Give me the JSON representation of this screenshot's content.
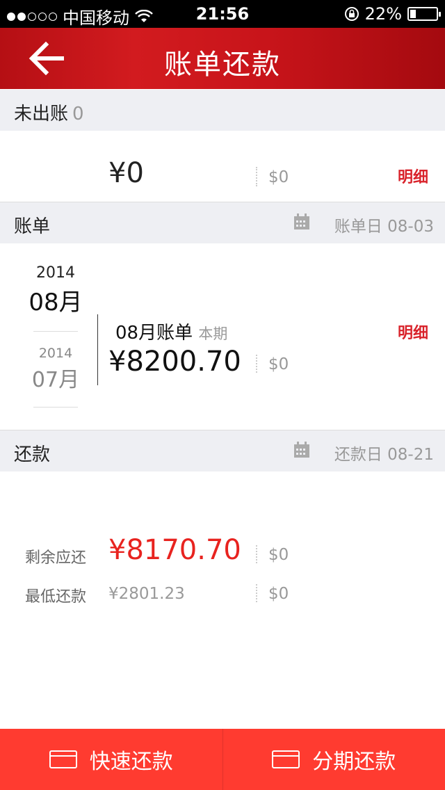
{
  "status_bar": {
    "carrier": "中国移动",
    "time": "21:56",
    "battery": "22%",
    "battery_level": 0.22
  },
  "nav": {
    "title": "账单还款"
  },
  "unbilled": {
    "label": "未出账",
    "count": "0",
    "cny": "¥0",
    "usd": "$0",
    "detail": "明细"
  },
  "bill": {
    "label": "账单",
    "date": "账单日 08-03",
    "months": [
      {
        "year": "2014",
        "month": "08月"
      },
      {
        "year": "2014",
        "month": "07月"
      }
    ],
    "title": "08月账单",
    "period": "本期",
    "cny": "¥8200.70",
    "usd": "$0",
    "detail": "明细"
  },
  "repay": {
    "label": "还款",
    "date": "还款日 08-21",
    "remaining_label": "剩余应还",
    "remaining_cny": "¥8170.70",
    "remaining_usd": "$0",
    "min_label": "最低还款",
    "min_cny": "¥2801.23",
    "min_usd": "$0"
  },
  "actions": {
    "quick": "快速还款",
    "installment": "分期还款"
  },
  "colors": {
    "brand_red": "#c8141a",
    "accent_red": "#ff3b30",
    "amount_red": "#e8231f"
  }
}
